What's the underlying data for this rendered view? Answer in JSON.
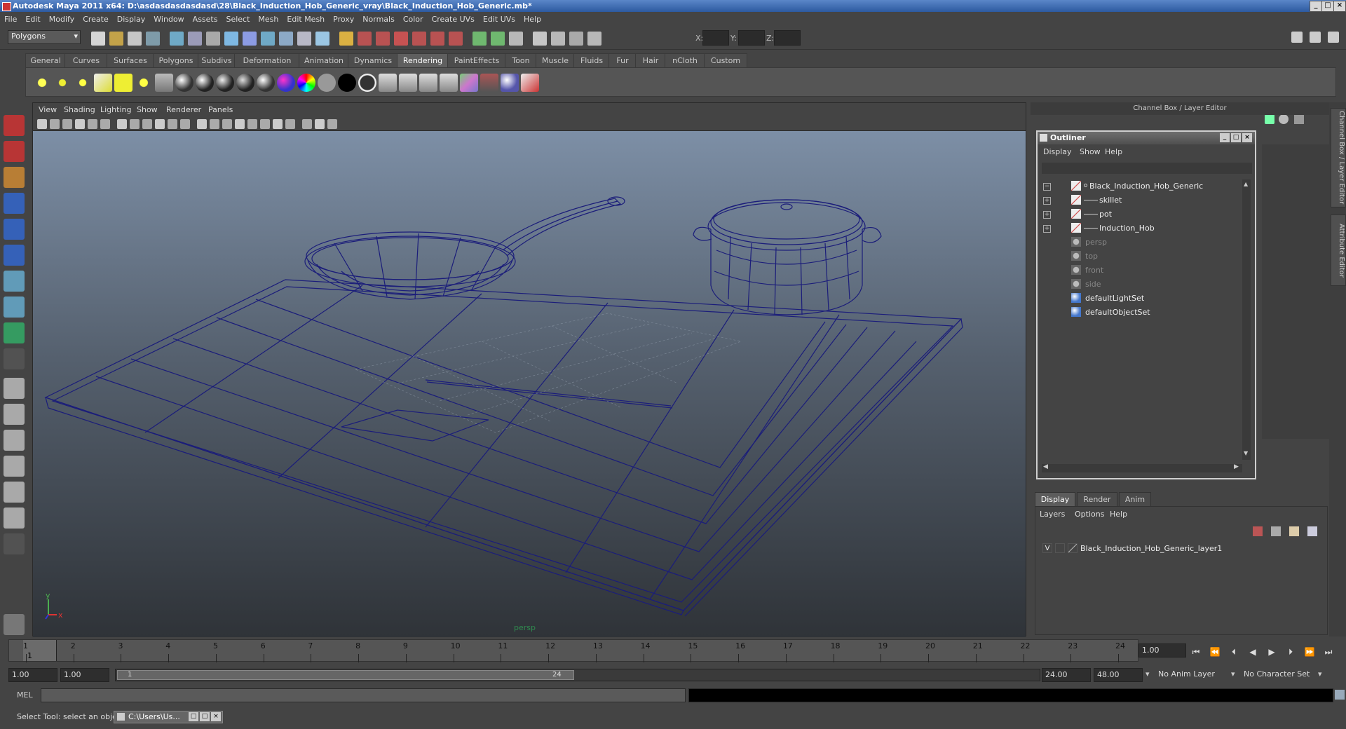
{
  "window": {
    "title": "Autodesk Maya 2011 x64: D:\\asdasdasdasdasd\\28\\Black_Induction_Hob_Generic_vray\\Black_Induction_Hob_Generic.mb*"
  },
  "menubar": [
    "File",
    "Edit",
    "Modify",
    "Create",
    "Display",
    "Window",
    "Assets",
    "Select",
    "Mesh",
    "Edit Mesh",
    "Proxy",
    "Normals",
    "Color",
    "Create UVs",
    "Edit UVs",
    "Help"
  ],
  "statusline": {
    "menuset": "Polygons",
    "x_label": "X:",
    "y_label": "Y:",
    "z_label": "Z:"
  },
  "shelf": {
    "tabs": [
      "General",
      "Curves",
      "Surfaces",
      "Polygons",
      "Subdivs",
      "Deformation",
      "Animation",
      "Dynamics",
      "Rendering",
      "PaintEffects",
      "Toon",
      "Muscle",
      "Fluids",
      "Fur",
      "Hair",
      "nCloth",
      "Custom"
    ],
    "active_tab": "Rendering"
  },
  "viewport": {
    "menu": [
      "View",
      "Shading",
      "Lighting",
      "Show",
      "Renderer",
      "Panels"
    ],
    "camera_label": "persp",
    "axis_y": "y",
    "axis_x": "x",
    "wire_color": "#1b1d7a"
  },
  "channel_box": {
    "title": "Channel Box / Layer Editor"
  },
  "side_tabs": {
    "channel": "Channel Box / Layer Editor",
    "attribute": "Attribute Editor"
  },
  "outliner": {
    "title": "Outliner",
    "menu": [
      "Display",
      "Show",
      "Help"
    ],
    "items": [
      {
        "label": "Black_Induction_Hob_Generic",
        "indent": 0,
        "expander": "−",
        "icon": "transform-icon",
        "dim": false
      },
      {
        "label": "skillet",
        "indent": 1,
        "expander": "+",
        "icon": "transform-icon",
        "dim": false
      },
      {
        "label": "pot",
        "indent": 1,
        "expander": "+",
        "icon": "transform-icon",
        "dim": false
      },
      {
        "label": "Induction_Hob",
        "indent": 1,
        "expander": "+",
        "icon": "transform-icon",
        "dim": false
      },
      {
        "label": "persp",
        "indent": 0,
        "expander": "",
        "icon": "camera-icon",
        "dim": true
      },
      {
        "label": "top",
        "indent": 0,
        "expander": "",
        "icon": "camera-icon",
        "dim": true
      },
      {
        "label": "front",
        "indent": 0,
        "expander": "",
        "icon": "camera-icon",
        "dim": true
      },
      {
        "label": "side",
        "indent": 0,
        "expander": "",
        "icon": "camera-icon",
        "dim": true
      },
      {
        "label": "defaultLightSet",
        "indent": 0,
        "expander": "",
        "icon": "set-icon",
        "dim": false
      },
      {
        "label": "defaultObjectSet",
        "indent": 0,
        "expander": "",
        "icon": "set-icon",
        "dim": false
      }
    ]
  },
  "layer_editor": {
    "tabs": [
      "Display",
      "Render",
      "Anim"
    ],
    "menu": [
      "Layers",
      "Options",
      "Help"
    ],
    "layer": {
      "visible": "V",
      "name": "Black_Induction_Hob_Generic_layer1"
    }
  },
  "time_slider": {
    "ticks": [
      "1",
      "2",
      "3",
      "4",
      "5",
      "6",
      "7",
      "8",
      "9",
      "10",
      "11",
      "12",
      "13",
      "14",
      "15",
      "16",
      "17",
      "18",
      "19",
      "20",
      "21",
      "22",
      "23",
      "24"
    ],
    "current_frame_marker": "1",
    "current_time": "1.00"
  },
  "range_slider": {
    "start_time": "1.00",
    "playback_start": "1.00",
    "range_start_label": "1",
    "range_end_label": "24",
    "playback_end": "24.00",
    "end_time": "48.00",
    "anim_layer": "No Anim Layer",
    "character_set": "No Character Set"
  },
  "command_line": {
    "label": "MEL"
  },
  "help_line": {
    "text": "Select Tool: select an object",
    "taskbar_item": "C:\\Users\\Us..."
  }
}
